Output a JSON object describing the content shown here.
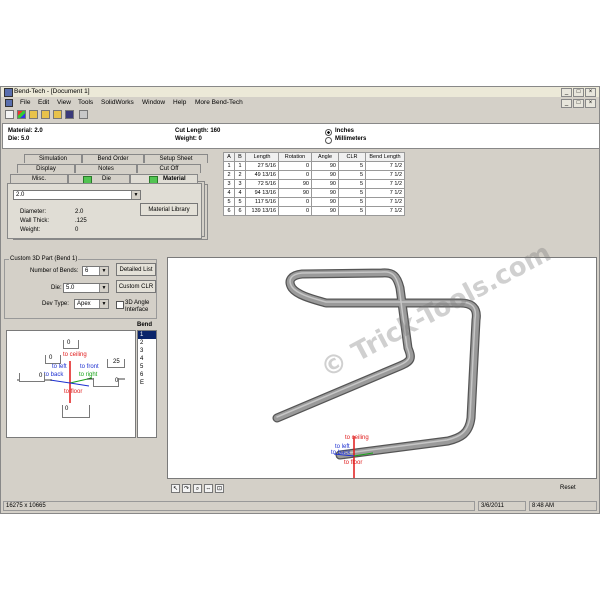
{
  "window": {
    "title": "Bend-Tech - [Document 1]",
    "controls": [
      "_",
      "□",
      "×"
    ]
  },
  "menu": [
    "File",
    "Edit",
    "View",
    "Tools",
    "SolidWorks",
    "Window",
    "Help",
    "More Bend-Tech"
  ],
  "toolbar_icons": [
    "new-icon",
    "color-icon",
    "open-icon",
    "open-folder-icon",
    "save-icon",
    "disk-icon",
    "print-icon"
  ],
  "header": {
    "material": "Material: 2.0",
    "die": "Die: 5.0",
    "cut_length": "Cut Length: 160",
    "weight": "Weight: 0",
    "units": {
      "inches": "Inches",
      "millimeters": "Millimeters"
    }
  },
  "tabs": {
    "row1": [
      "Simulation",
      "Bend Order",
      "Setup Sheet"
    ],
    "row2": [
      "Display",
      "Notes",
      "Cut Off"
    ],
    "row3": [
      "Misc.",
      "Die",
      "Material"
    ]
  },
  "material_panel": {
    "selected": "2.0",
    "library_button": "Material Library",
    "diameter_label": "Diameter:",
    "diameter_value": "2.0",
    "wall_label": "Wall Thick:",
    "wall_value": ".125",
    "weight_label": "Weight:",
    "weight_value": "0"
  },
  "bend_table": {
    "headers": [
      "A",
      "B",
      "Length",
      "Rotation",
      "Angle",
      "CLR",
      "Bend Length"
    ],
    "rows": [
      [
        "1",
        "1",
        "27 5/16",
        "0",
        "90",
        "5",
        "7 1/2"
      ],
      [
        "2",
        "2",
        "49 13/16",
        "0",
        "90",
        "5",
        "7 1/2"
      ],
      [
        "3",
        "3",
        "72 5/16",
        "90",
        "90",
        "5",
        "7 1/2"
      ],
      [
        "4",
        "4",
        "94 13/16",
        "90",
        "90",
        "5",
        "7 1/2"
      ],
      [
        "5",
        "5",
        "117 5/16",
        "0",
        "90",
        "5",
        "7 1/2"
      ],
      [
        "6",
        "6",
        "139 13/16",
        "0",
        "90",
        "5",
        "7 1/2"
      ]
    ]
  },
  "custom_part": {
    "group_title": "Custom 3D Part (Bend 1)",
    "num_bends_label": "Number of Bends:",
    "num_bends_value": "6",
    "detailed_list": "Detailed List",
    "die_label": "Die:",
    "die_value": "5.0",
    "custom_clr": "Custom CLR",
    "dev_type_label": "Dev Type:",
    "dev_type_value": "Apex",
    "angle_interface": "3D Angle Interface",
    "bend_list_title": "Bend",
    "bend_list": [
      "1",
      "2",
      "3",
      "4",
      "5",
      "6",
      "E"
    ]
  },
  "angle_widget": {
    "to_ceiling": "to ceiling",
    "to_left": "to left",
    "to_front": "to front",
    "to_back": "to back",
    "to_right": "to right",
    "to_floor": "to floor",
    "v_top": "0",
    "v_left": "0",
    "v_right": "25",
    "v_mid_left": "0",
    "v_mid_right": "0",
    "v_bottom": "0"
  },
  "viewport": {
    "axis": {
      "to_ceiling": "to ceiling",
      "to_left": "to left",
      "to_back": "to back",
      "to_floor": "to floor"
    },
    "reset": "Reset",
    "tools": [
      "pointer-icon",
      "rotate-icon",
      "zoom-icon",
      "fit-icon",
      "zoom-window-icon"
    ]
  },
  "watermark": "© Trick-Tools.com",
  "status": {
    "coords": "16275 x 10665",
    "date": "3/6/2011",
    "time": "8:48 AM"
  },
  "colors": {
    "chrome": "#d4d0c8",
    "tube": "#8a8a8a",
    "axis_red": "#e01818",
    "axis_blue": "#1c2fd0",
    "axis_green": "#17a317",
    "selection": "#0a246a"
  }
}
